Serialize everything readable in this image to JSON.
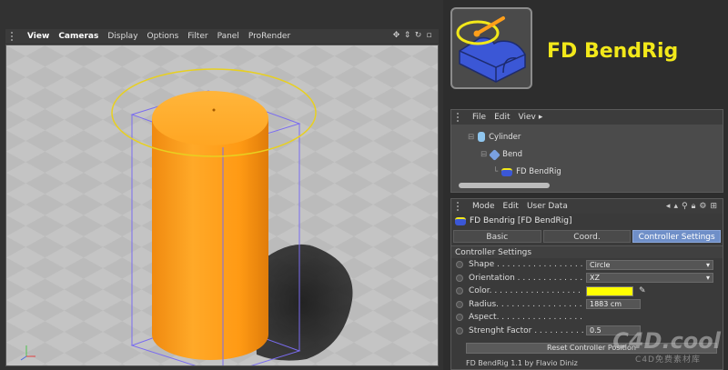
{
  "viewport": {
    "menu": [
      "View",
      "Cameras",
      "Display",
      "Options",
      "Filter",
      "Panel",
      "ProRender"
    ],
    "icons": [
      "move-icon",
      "zoom-icon",
      "rotate-icon",
      "maximize-icon"
    ],
    "cylinder_color": "#ff9f1a",
    "circle_color": "#e8d020",
    "bbox_color": "#7a6cf0"
  },
  "brand": {
    "title": "FD BendRig"
  },
  "object_manager": {
    "menu": [
      "File",
      "Edit",
      "Viev"
    ],
    "objects": [
      {
        "name": "Cylinder",
        "icon": "cylinder-icon"
      },
      {
        "name": "Bend",
        "icon": "bend-deformer-icon"
      },
      {
        "name": "FD BendRig",
        "icon": "bendrig-icon"
      }
    ]
  },
  "attributes": {
    "menu": [
      "Mode",
      "Edit",
      "User Data"
    ],
    "title": "FD Bendrig [FD BendRig]",
    "tabs": [
      "Basic",
      "Coord.",
      "Controller Settings"
    ],
    "selected_tab": "Controller Settings",
    "section": "Controller Settings",
    "params": {
      "shape": {
        "label": "Shape . . . . . . . . . . . . . . . . . .",
        "value": "Circle"
      },
      "orientation": {
        "label": "Orientation  . . . . . . . . . . . . .",
        "value": "XZ"
      },
      "color": {
        "label": "Color. . . . . . . . . . . . . . . . . .",
        "value": "#ffff00"
      },
      "radius": {
        "label": "Radius. . . . . . . . . . . . . . . . .",
        "value": "1883 cm"
      },
      "aspect": {
        "label": "Aspect. . . . . . . . . . . . . . . . .",
        "value": ""
      },
      "strength": {
        "label": "Strenght Factor . . . . . . . . . .",
        "value": "0.5"
      }
    },
    "reset_button": "Reset Controller Position",
    "credit": "FD BendRig 1.1 by Flavio Diniz"
  },
  "watermark": {
    "main": "C4D.cool",
    "sub": "C4D免费素材库"
  }
}
